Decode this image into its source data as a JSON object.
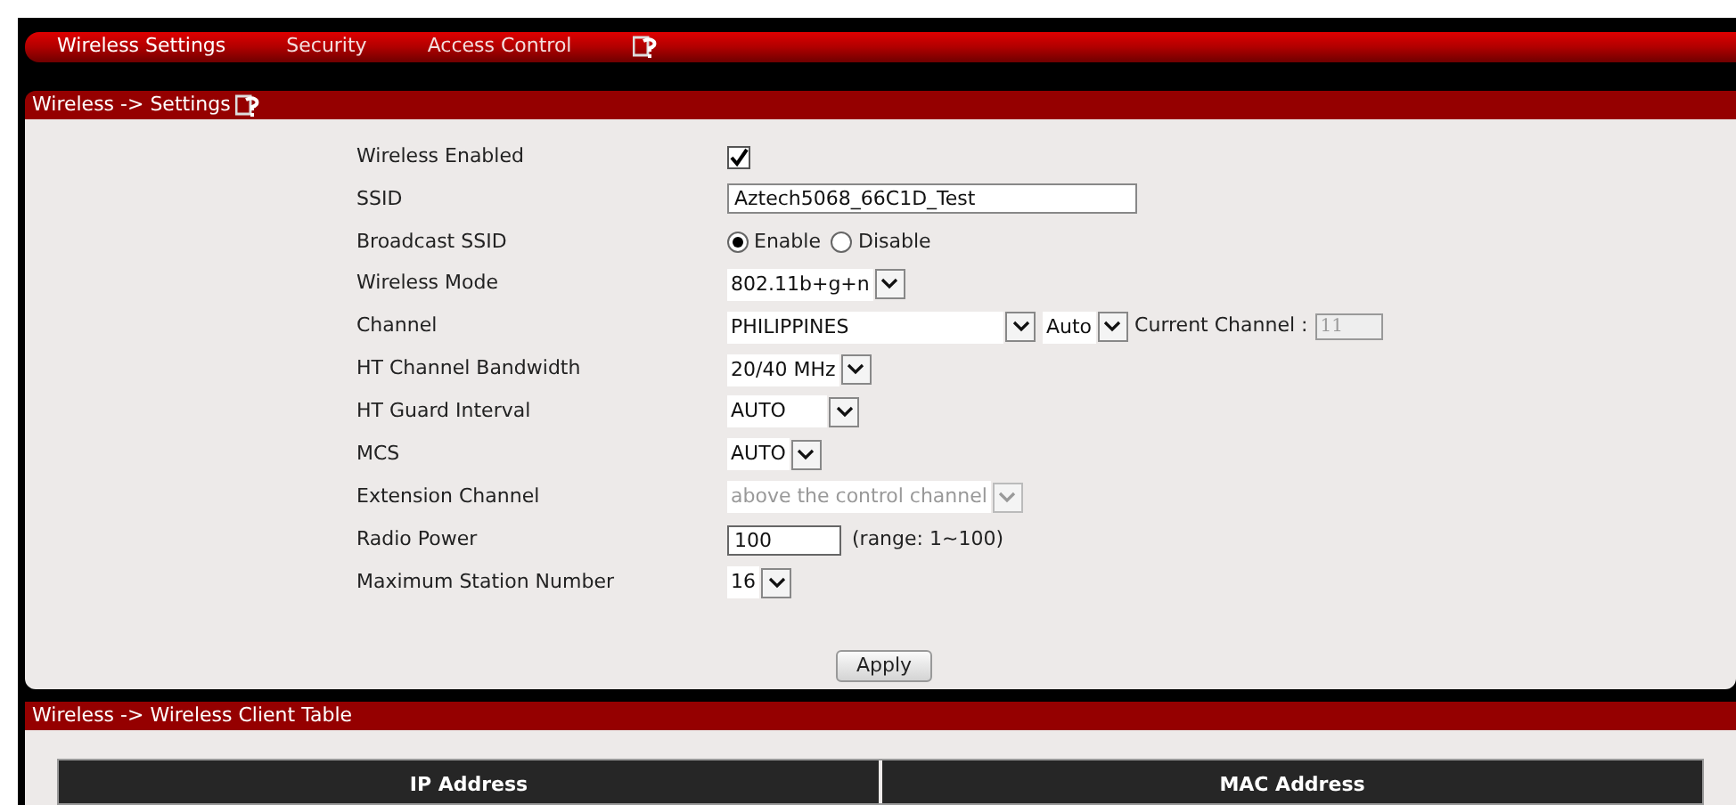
{
  "nav": {
    "tabs": [
      {
        "label": "Wireless Settings",
        "selected": true
      },
      {
        "label": "Security",
        "selected": false
      },
      {
        "label": "Access Control",
        "selected": false
      }
    ]
  },
  "settings": {
    "title": "Wireless -> Settings",
    "rows": [
      {
        "kind": "checkbox",
        "label": "Wireless Enabled",
        "checked": true
      },
      {
        "kind": "text",
        "label": "SSID",
        "value": "Aztech5068_66C1D_Test"
      },
      {
        "kind": "radio",
        "label": "Broadcast SSID",
        "options": [
          {
            "label": "Enable",
            "selected": true
          },
          {
            "label": "Disable",
            "selected": false
          }
        ]
      },
      {
        "kind": "select",
        "label": "Wireless Mode",
        "value": "802.11b+g+n",
        "disabled": false
      },
      {
        "kind": "channel",
        "label": "Channel",
        "country": "PHILIPPINES",
        "channel": "Auto",
        "current_label": "Current Channel :",
        "current": "11"
      },
      {
        "kind": "select",
        "label": "HT Channel Bandwidth",
        "value": "20/40 MHz",
        "disabled": false
      },
      {
        "kind": "select",
        "label": "HT Guard Interval",
        "value": "AUTO",
        "disabled": false,
        "wide": true
      },
      {
        "kind": "select",
        "label": "MCS",
        "value": "AUTO",
        "disabled": false
      },
      {
        "kind": "select",
        "label": "Extension Channel",
        "value": "above the control channel",
        "disabled": true
      },
      {
        "kind": "number",
        "label": "Radio Power",
        "value": "100",
        "note": "(range: 1~100)"
      },
      {
        "kind": "select",
        "label": "Maximum Station Number",
        "value": "16",
        "disabled": false
      }
    ],
    "apply": "Apply"
  },
  "client_table": {
    "title": "Wireless -> Wireless Client Table",
    "columns": [
      "IP Address",
      "MAC Address"
    ]
  }
}
